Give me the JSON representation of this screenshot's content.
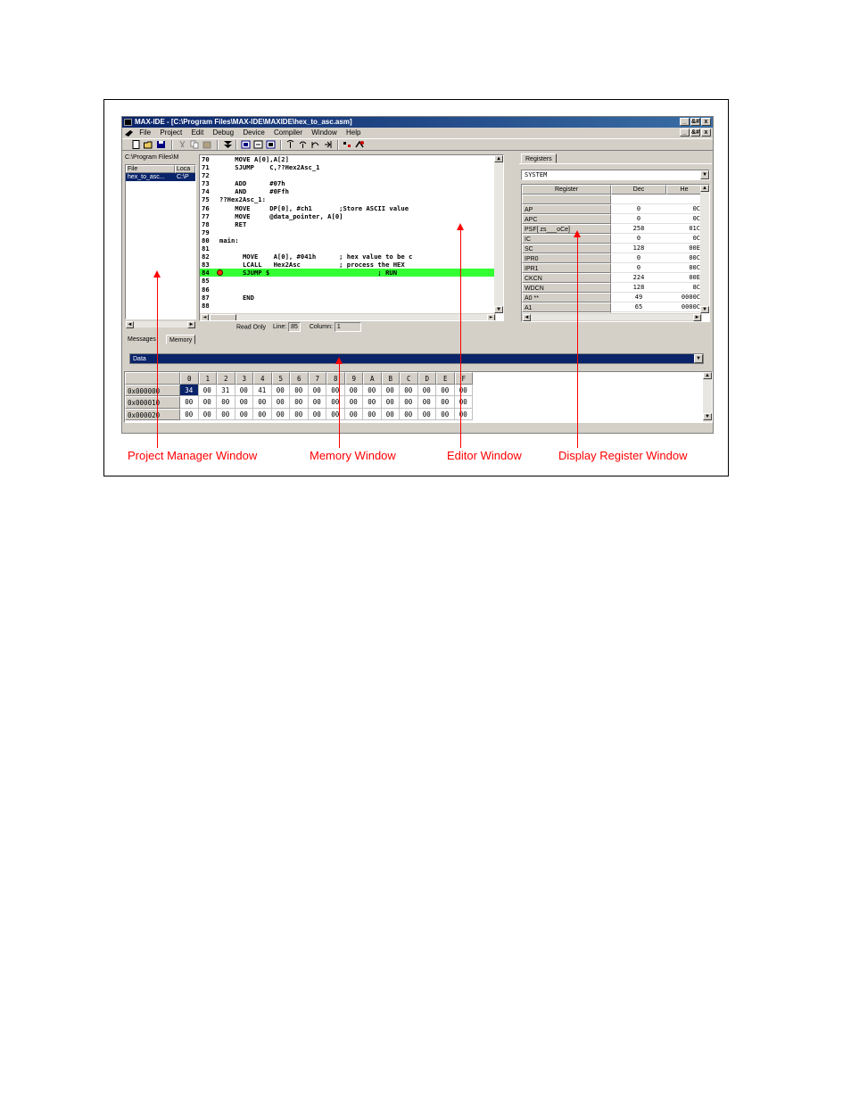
{
  "window": {
    "title": "MAX-IDE - [C:\\Program Files\\MAX-IDE\\MAXIDE\\hex_to_asc.asm]",
    "buttons": [
      "_",
      "&#",
      "x"
    ]
  },
  "menu": [
    "File",
    "Project",
    "Edit",
    "Debug",
    "Device",
    "Compiler",
    "Window",
    "Help"
  ],
  "project": {
    "path": "C:\\Program Files\\M",
    "columns": [
      "File",
      "Loca"
    ],
    "rows": [
      [
        "hex_to_asc...",
        "C:\\P"
      ]
    ]
  },
  "editor": {
    "lines": [
      {
        "num": "70",
        "code": "    MOVE A[0],A[2]"
      },
      {
        "num": "71",
        "code": "    SJUMP    C,??Hex2Asc_1"
      },
      {
        "num": "72",
        "code": ""
      },
      {
        "num": "73",
        "code": "    ADD      #07h"
      },
      {
        "num": "74",
        "code": "    AND      #0Ffh"
      },
      {
        "num": "75",
        "code": "??Hex2Asc_1:"
      },
      {
        "num": "76",
        "code": "    MOVE     DP[0], #ch1       ;Store ASCII value"
      },
      {
        "num": "77",
        "code": "    MOVE     @data_pointer, A[0]"
      },
      {
        "num": "78",
        "code": "    RET"
      },
      {
        "num": "79",
        "code": ""
      },
      {
        "num": "80",
        "code": "main:"
      },
      {
        "num": "81",
        "code": ""
      },
      {
        "num": "82",
        "code": "      MOVE    A[0], #041h      ; hex value to be c"
      },
      {
        "num": "83",
        "code": "      LCALL   Hex2Asc          ; process the HEX"
      },
      {
        "num": "84",
        "code": "      SJUMP $                            ; RUN"
      },
      {
        "num": "85",
        "code": ""
      },
      {
        "num": "86",
        "code": ""
      },
      {
        "num": "87",
        "code": "      END"
      },
      {
        "num": "88",
        "code": ""
      }
    ],
    "status_mode": "Read Only",
    "line_label": "Line:",
    "line_value": "85",
    "col_label": "Column:",
    "col_value": "1"
  },
  "registers": {
    "tab": "Registers",
    "dropdown": "SYSTEM",
    "columns": [
      "Register",
      "Dec",
      "He"
    ],
    "rows": [
      [
        "",
        "",
        ""
      ],
      [
        "AP",
        "0",
        "0C"
      ],
      [
        "APC",
        "0",
        "0C"
      ],
      [
        "PSF[ zs___oCe]",
        "258",
        "01C"
      ],
      [
        "IC",
        "0",
        "0C"
      ],
      [
        "SC",
        "128",
        "00E"
      ],
      [
        "IPR0",
        "0",
        "00C"
      ],
      [
        "IPR1",
        "0",
        "00C"
      ],
      [
        "CKCN",
        "224",
        "00E"
      ],
      [
        "WDCN",
        "128",
        "8C"
      ],
      [
        "A0 **",
        "49",
        "0000C"
      ],
      [
        "A1",
        "65",
        "0000C"
      ],
      [
        "A2",
        "49",
        "0000C"
      ]
    ]
  },
  "bottom": {
    "tabs": [
      "Messages",
      "Memory"
    ],
    "dropdown": "Data",
    "mem_headers": [
      "0",
      "1",
      "2",
      "3",
      "4",
      "5",
      "6",
      "7",
      "8",
      "9",
      "A",
      "B",
      "C",
      "D",
      "E",
      "F"
    ],
    "mem_rows": [
      {
        "addr": "0x000000",
        "cells": [
          "34",
          "00",
          "31",
          "00",
          "41",
          "00",
          "00",
          "00",
          "00",
          "00",
          "00",
          "00",
          "00",
          "00",
          "00",
          "00"
        ]
      },
      {
        "addr": "0x000010",
        "cells": [
          "00",
          "00",
          "00",
          "00",
          "00",
          "00",
          "00",
          "00",
          "00",
          "00",
          "00",
          "00",
          "00",
          "00",
          "00",
          "00"
        ]
      },
      {
        "addr": "0x000020",
        "cells": [
          "00",
          "00",
          "00",
          "00",
          "00",
          "00",
          "00",
          "00",
          "00",
          "00",
          "00",
          "00",
          "00",
          "00",
          "00",
          "00"
        ]
      }
    ]
  },
  "callouts": {
    "project": "Project Manager Window",
    "memory": "Memory Window",
    "editor": "Editor Window",
    "registers": "Display Register Window"
  },
  "colors": {
    "callout": "#ff0000",
    "highlight_line": "#33ff33",
    "selection": "#0a246a"
  }
}
